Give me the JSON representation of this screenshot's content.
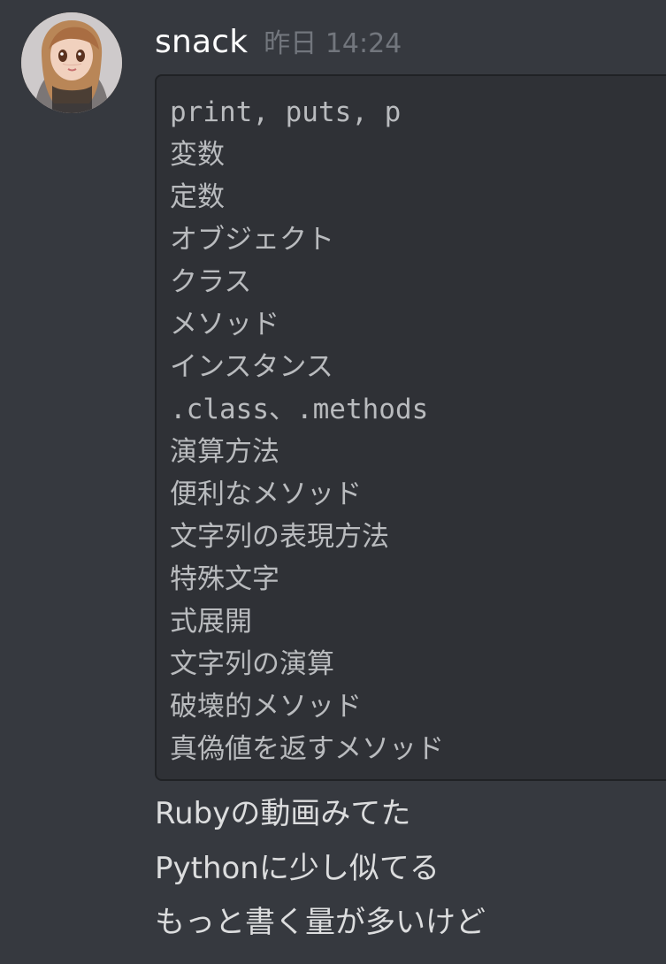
{
  "message": {
    "author": "snack",
    "timestamp": "昨日 14:24",
    "code_block": {
      "lines": [
        "print, puts, p",
        "変数",
        "定数",
        "オブジェクト",
        "クラス",
        "メソッド",
        "インスタンス",
        ".class、.methods",
        "演算方法",
        "便利なメソッド",
        "文字列の表現方法",
        "特殊文字",
        "式展開",
        "文字列の演算",
        "破壊的メソッド",
        "真偽値を返すメソッド"
      ]
    },
    "text_lines": [
      "Rubyの動画みてた",
      "Pythonに少し似てる",
      "もっと書く量が多いけど"
    ]
  },
  "colors": {
    "background": "#36393f",
    "code_background": "#2f3136",
    "username": "#ffffff",
    "timestamp": "#72767d",
    "code_text": "#b9bbbe",
    "message_text": "#dcddde"
  },
  "icons": {
    "avatar": "user-avatar"
  }
}
